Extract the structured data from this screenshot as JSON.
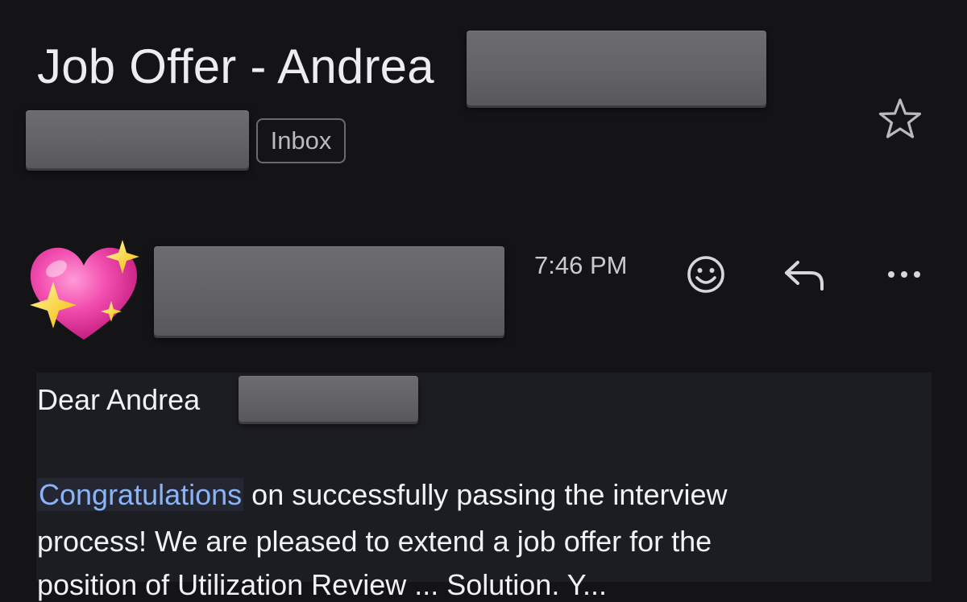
{
  "header": {
    "subject": "Job Offer - Andrea",
    "label_inbox": "Inbox",
    "star_icon": "star-outline-icon"
  },
  "message": {
    "sender_avatar": "sparkling-heart-emoji",
    "time": "7:46 PM",
    "actions": {
      "react_icon": "smiley-icon",
      "reply_icon": "reply-arrow-icon",
      "more_icon": "more-horizontal-icon"
    },
    "body": {
      "greeting": "Dear Andrea",
      "line1_link": "Congratulations",
      "line1_rest": " on successfully passing the interview",
      "line2": "process! We are pleased to extend a job offer for the",
      "line3": "position of Utilization Review ... Solution. Y..."
    }
  },
  "colors": {
    "background": "#141417",
    "body_background": "#1c1d22",
    "link": "#8ab4f8",
    "label_border": "#6b6b6f"
  }
}
